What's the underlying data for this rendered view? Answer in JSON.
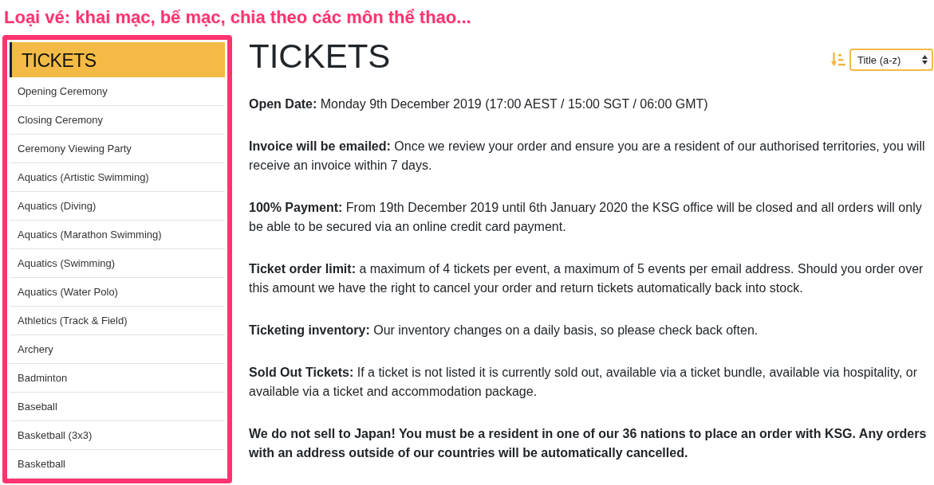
{
  "annotation": {
    "text": "Loại vé: khai mạc, bế mạc, chia theo các môn thể thao..."
  },
  "sidebar": {
    "title": "TICKETS",
    "items": [
      {
        "label": "Opening Ceremony"
      },
      {
        "label": "Closing Ceremony"
      },
      {
        "label": "Ceremony Viewing Party"
      },
      {
        "label": "Aquatics (Artistic Swimming)"
      },
      {
        "label": "Aquatics (Diving)"
      },
      {
        "label": "Aquatics (Marathon Swimming)"
      },
      {
        "label": "Aquatics (Swimming)"
      },
      {
        "label": "Aquatics (Water Polo)"
      },
      {
        "label": "Athletics (Track & Field)"
      },
      {
        "label": "Archery"
      },
      {
        "label": "Badminton"
      },
      {
        "label": "Baseball"
      },
      {
        "label": "Basketball (3x3)"
      },
      {
        "label": "Basketball"
      }
    ]
  },
  "page": {
    "title": "TICKETS",
    "sort": {
      "value": "Title (a-z)"
    },
    "paragraphs": [
      {
        "kind": "info",
        "text": "**Open Date:** Monday 9th December 2019 (17:00 AEST / 15:00 SGT / 06:00 GMT)"
      },
      {
        "kind": "info",
        "text": "**Invoice will be emailed:** Once we review your order and ensure you are a resident of our authorised territories, you will receive an invoice within 7 days."
      },
      {
        "kind": "info",
        "text": "**100% Payment:** From 19th December 2019 until 6th January 2020 the KSG office will be closed and all orders will only be able to be secured via an online credit card payment."
      },
      {
        "kind": "info",
        "text": "**Ticket order limit:** a maximum of 4 tickets per event, a maximum of 5 events per email address. Should you order over this amount we have the right to cancel your order and return tickets automatically back into stock."
      },
      {
        "kind": "info",
        "text": "**Ticketing inventory:** Our inventory changes on a daily basis, so please check back often."
      },
      {
        "kind": "info",
        "text": "**Sold Out Tickets:** If a ticket is not listed it is currently sold out, available via a ticket bundle, available via hospitality, or available via a ticket and accommodation package."
      },
      {
        "kind": "notice",
        "text": "We do not sell to Japan! You must be a resident in one of our 36 nations to place an order with KSG. Any orders with an address outside of our countries will be automatically cancelled."
      }
    ]
  }
}
